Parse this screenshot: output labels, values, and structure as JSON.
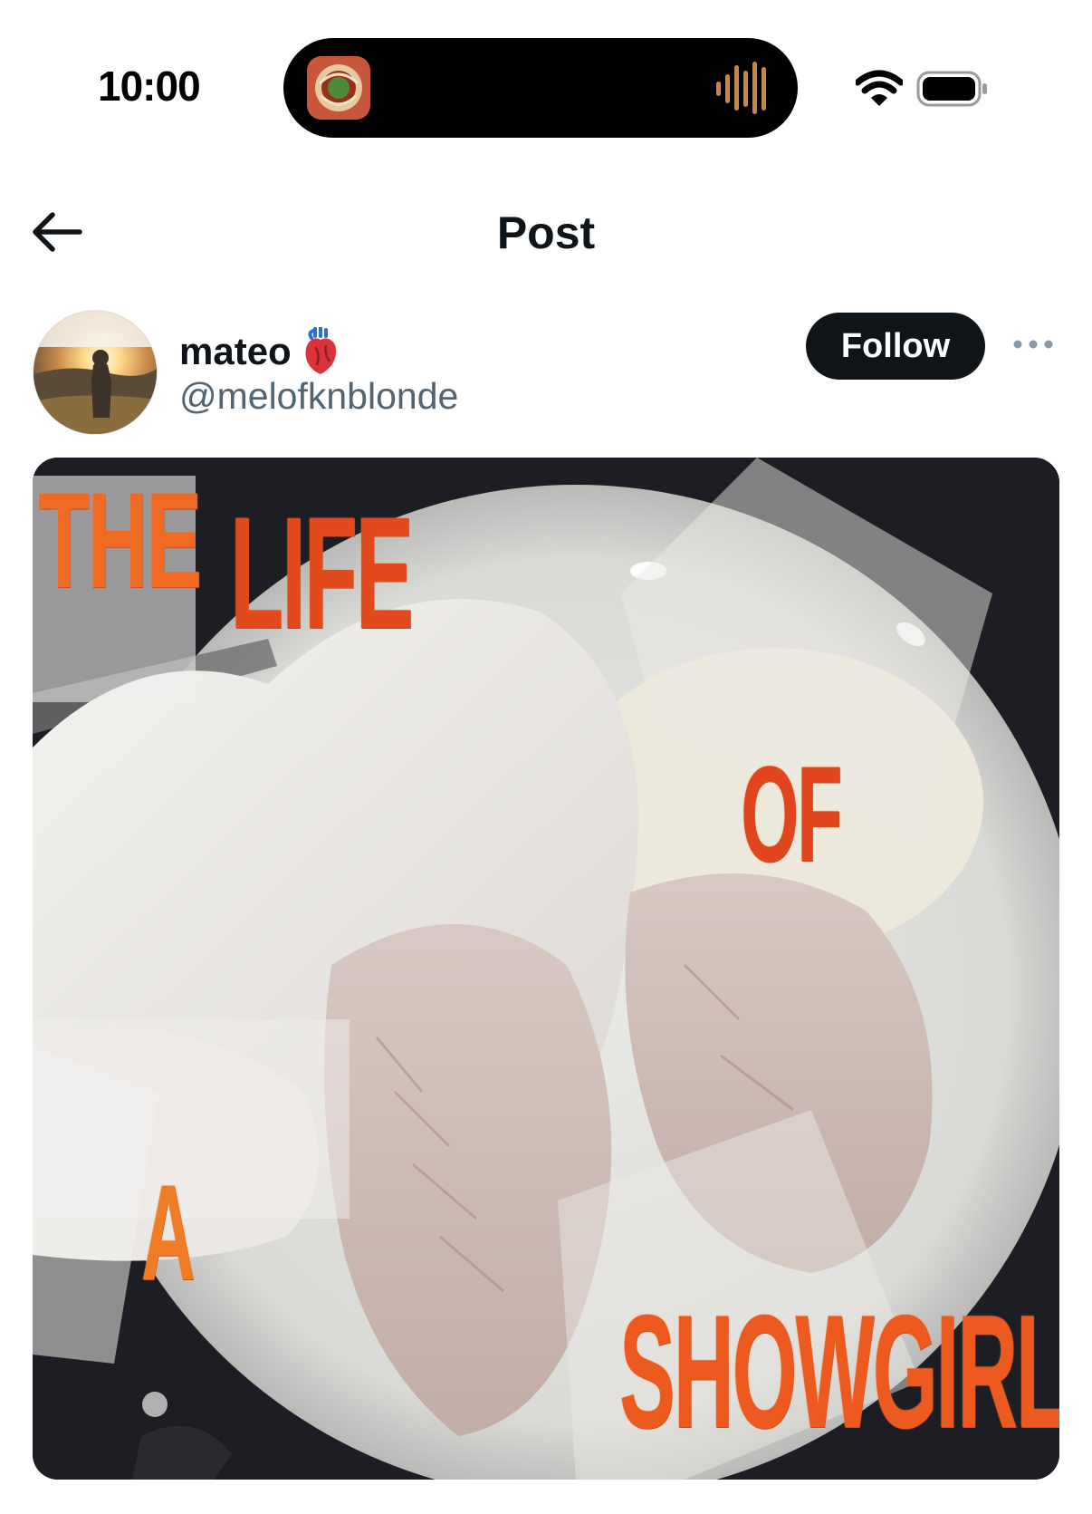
{
  "status_bar": {
    "time": "10:00",
    "island_artwork_icon": "album-art-icon",
    "island_audio_icon": "audio-waveform-icon",
    "wifi_icon": "wifi-icon",
    "battery_icon": "battery-icon"
  },
  "header": {
    "back_icon": "arrow-left-icon",
    "title": "Post"
  },
  "author": {
    "display_name": "mateo",
    "name_emoji": "anatomical-heart-icon",
    "handle": "@melofknblonde",
    "follow_label": "Follow",
    "more_icon": "more-horizontal-icon"
  },
  "post_image": {
    "overlay_words": [
      "THE",
      "LIFE",
      "OF",
      "A",
      "SHOWGIRL"
    ]
  },
  "colors": {
    "text_primary": "#0f1419",
    "text_secondary": "#536471",
    "follow_bg": "#0f1419",
    "overlay_orange": "#e8541f"
  }
}
